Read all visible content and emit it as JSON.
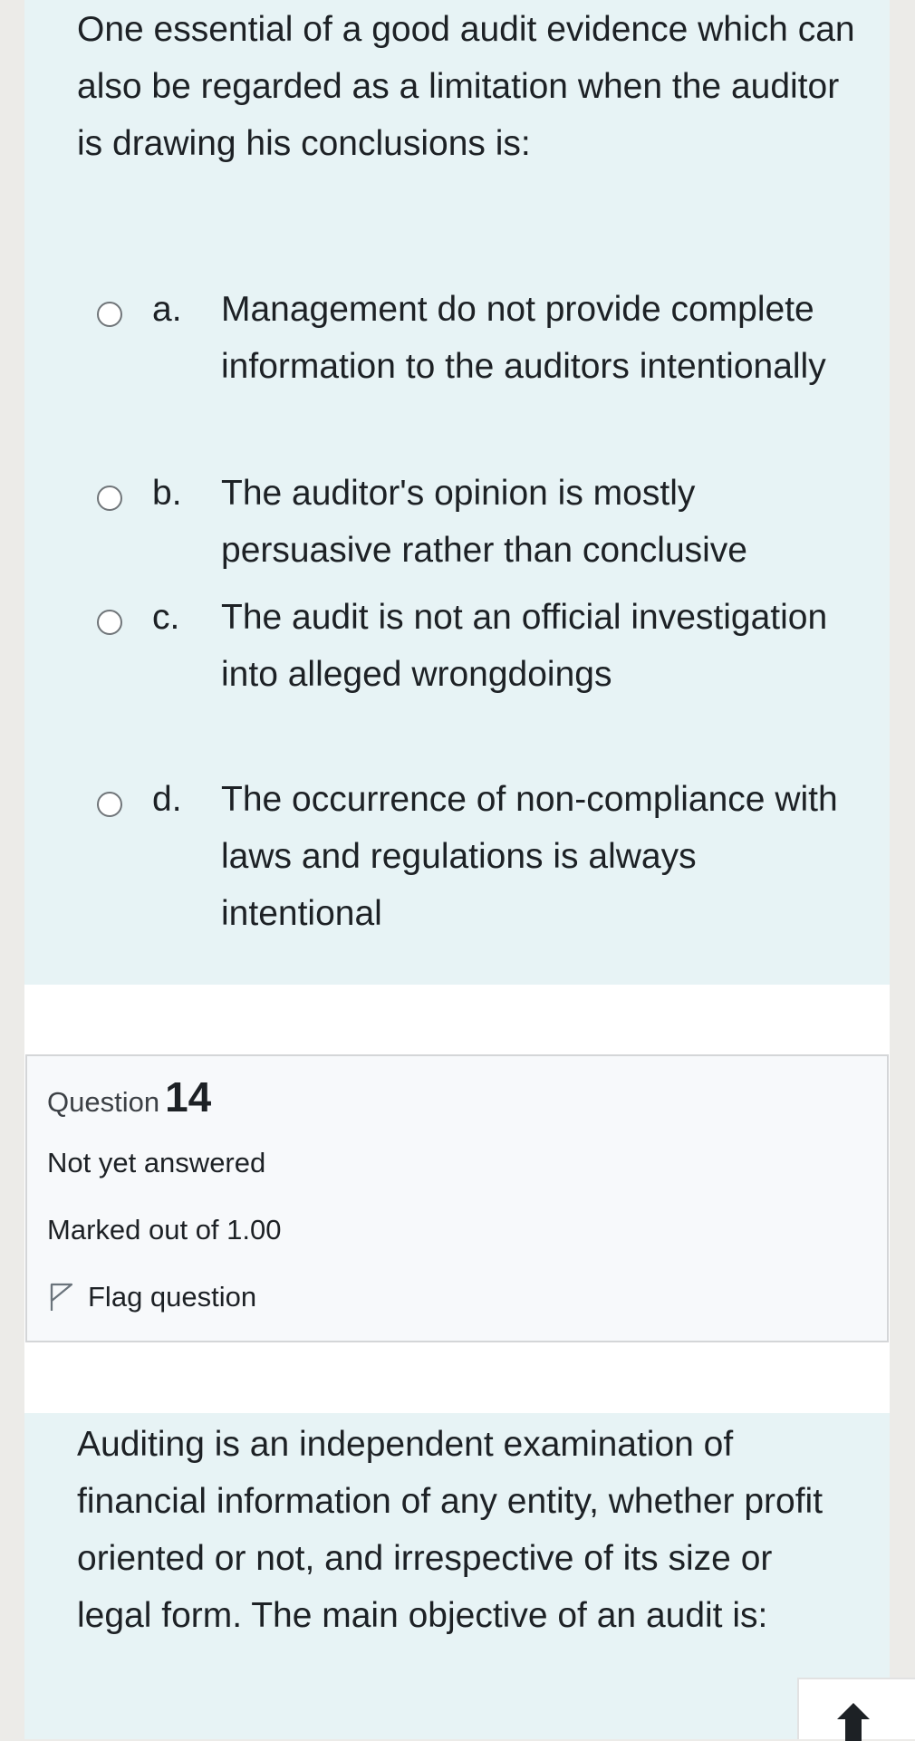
{
  "question13": {
    "text": "One essential of a good audit evidence which can also be regarded as a limitation when the auditor is drawing his conclusions is:",
    "answers": [
      {
        "letter": "a.",
        "text": "Management do not provide complete information to the auditors intentionally"
      },
      {
        "letter": "b.",
        "text": "The auditor's opinion is mostly persuasive rather than conclusive"
      },
      {
        "letter": "c.",
        "text": "The audit is not an official investigation into alleged wrongdoings"
      },
      {
        "letter": "d.",
        "text": "The occurrence of non-compliance with laws and regulations is always intentional"
      }
    ]
  },
  "question14": {
    "info": {
      "label": "Question",
      "number": "14",
      "state": "Not yet answered",
      "grade": "Marked out of 1.00",
      "flag_label": "Flag question"
    },
    "text": "Auditing is an independent examination of financial information of any entity, whether profit oriented or not, and irrespective of its size or legal form. The main objective of an audit is:"
  },
  "icons": {
    "flag": "flag-outline-icon",
    "back_to_top": "arrow-up-icon"
  },
  "colors": {
    "question_bg": "#e7f3f5",
    "info_bg": "#f7f9fb",
    "text": "#1d2125"
  }
}
